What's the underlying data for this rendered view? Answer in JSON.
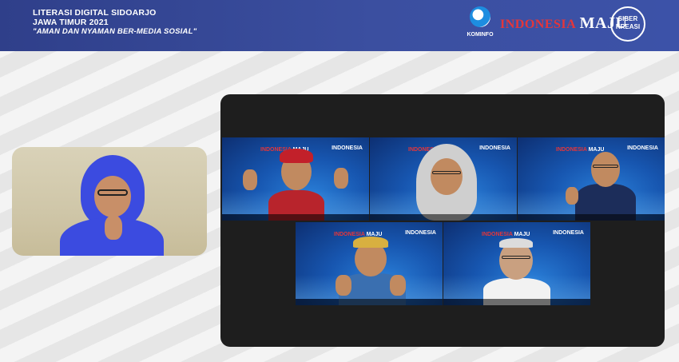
{
  "header": {
    "line1": "LITERASI DIGITAL SIDOARJO",
    "line2": "JAWA TIMUR 2021",
    "line3": "\"AMAN DAN NYAMAN BER-MEDIA SOSIAL\"",
    "logo_kominfo": "KOMINFO",
    "logo_indonesia": "INDONESIA",
    "logo_maju": "MAJU",
    "logo_siber": "SIBER",
    "logo_kreasi": "KREASI"
  },
  "tile_brand": {
    "indonesia": "INDONESIA",
    "maju": "MAJU"
  },
  "colors": {
    "header_bg": "#34469a",
    "accent_red": "#e4363a",
    "panel_bg": "#1e1e1e",
    "tile_blue": "#1756b0",
    "self_hijab": "#3b4be0"
  }
}
